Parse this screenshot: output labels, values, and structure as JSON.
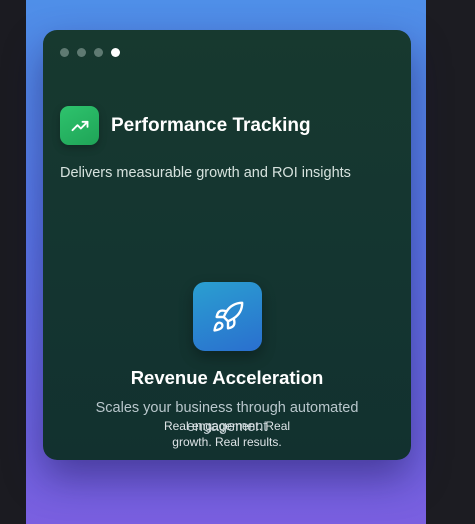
{
  "dots": [
    {
      "active": false
    },
    {
      "active": false
    },
    {
      "active": false
    },
    {
      "active": true
    }
  ],
  "feature": {
    "icon": "trending-up-icon",
    "title": "Performance Tracking",
    "description": "Delivers measurable growth and ROI insights"
  },
  "hero": {
    "icon": "rocket-icon",
    "title": "Revenue Acceleration",
    "description": "Scales your business through automated engagement",
    "tagline": "Real engagement. Real growth. Real results."
  },
  "colors": {
    "feature_icon_bg": "#22b360",
    "rocket_tile_bg": "#2a8bd0",
    "card_bg": "#16372f",
    "backdrop_top": "#4f8fe8",
    "backdrop_bottom": "#7a5fe0"
  }
}
